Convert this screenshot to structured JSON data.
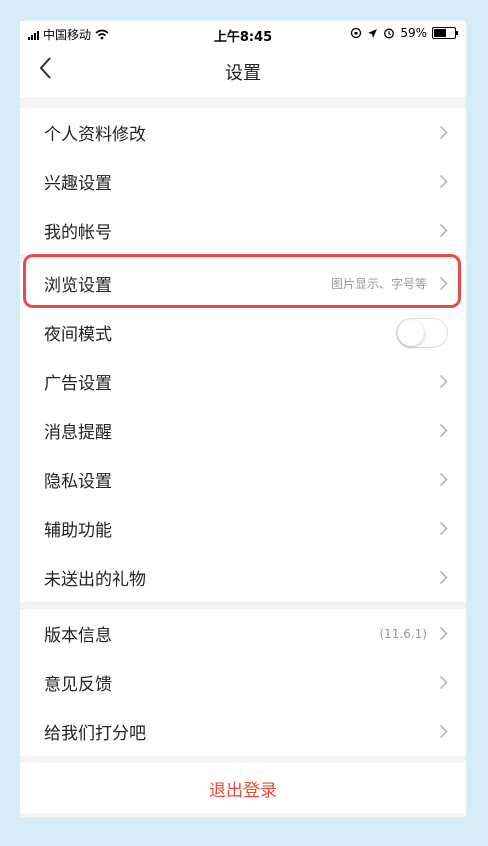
{
  "status_bar": {
    "carrier": "中国移动",
    "time": "上午8:45",
    "battery": "59%",
    "battery_level": 0.59
  },
  "nav": {
    "title": "设置",
    "back_icon": "chevron-left-icon"
  },
  "groups": [
    {
      "items": [
        {
          "label": "个人资料修改",
          "hint": "",
          "control": "chevron"
        },
        {
          "label": "兴趣设置",
          "hint": "",
          "control": "chevron"
        },
        {
          "label": "我的帐号",
          "hint": "",
          "control": "chevron"
        }
      ]
    },
    {
      "items": [
        {
          "label": "浏览设置",
          "hint": "图片显示、字号等",
          "control": "chevron",
          "highlighted": true
        },
        {
          "label": "夜间模式",
          "hint": "",
          "control": "toggle",
          "toggle_on": false
        },
        {
          "label": "广告设置",
          "hint": "",
          "control": "chevron"
        },
        {
          "label": "消息提醒",
          "hint": "",
          "control": "chevron"
        },
        {
          "label": "隐私设置",
          "hint": "",
          "control": "chevron"
        },
        {
          "label": "辅助功能",
          "hint": "",
          "control": "chevron"
        },
        {
          "label": "未送出的礼物",
          "hint": "",
          "control": "chevron"
        }
      ]
    },
    {
      "items": [
        {
          "label": "版本信息",
          "hint": "(11.6.1)",
          "control": "chevron"
        },
        {
          "label": "意见反馈",
          "hint": "",
          "control": "chevron"
        },
        {
          "label": "给我们打分吧",
          "hint": "",
          "control": "chevron"
        }
      ]
    }
  ],
  "logout_label": "退出登录",
  "colors": {
    "accent_red": "#e84b3b",
    "highlight_box": "#e84b4b",
    "background_frame": "#d8ecf8"
  }
}
